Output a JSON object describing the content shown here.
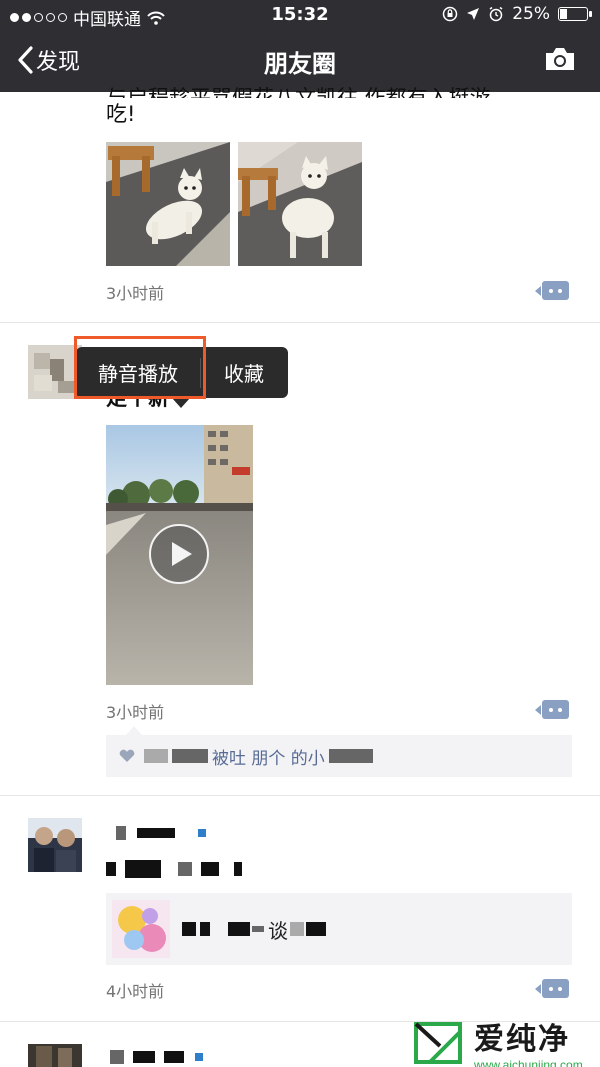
{
  "status_bar": {
    "carrier": "中国联通",
    "time": "15:32",
    "battery": "25%",
    "battery_level": 0.25
  },
  "nav": {
    "back_label": "发现",
    "title": "朋友圈"
  },
  "post1": {
    "text_top": "与启程趁平骂假花八文凯往 作都有入挺游",
    "text_line2": "吃!",
    "time": "3小时前"
  },
  "post2": {
    "text_partial": "足个新",
    "time": "3小时前",
    "comment": "被吐 朋个 的小"
  },
  "popup": {
    "mute_play": "静音播放",
    "favorite": "收藏"
  },
  "post3": {
    "text": "谈",
    "time": "4小时前"
  },
  "watermark": {
    "brand": "爱纯净",
    "url": "www.aichunjing.com"
  },
  "colors": {
    "header_bg": "#2e2e33",
    "highlight": "#ee5a2a",
    "link_blue": "#576b95"
  }
}
